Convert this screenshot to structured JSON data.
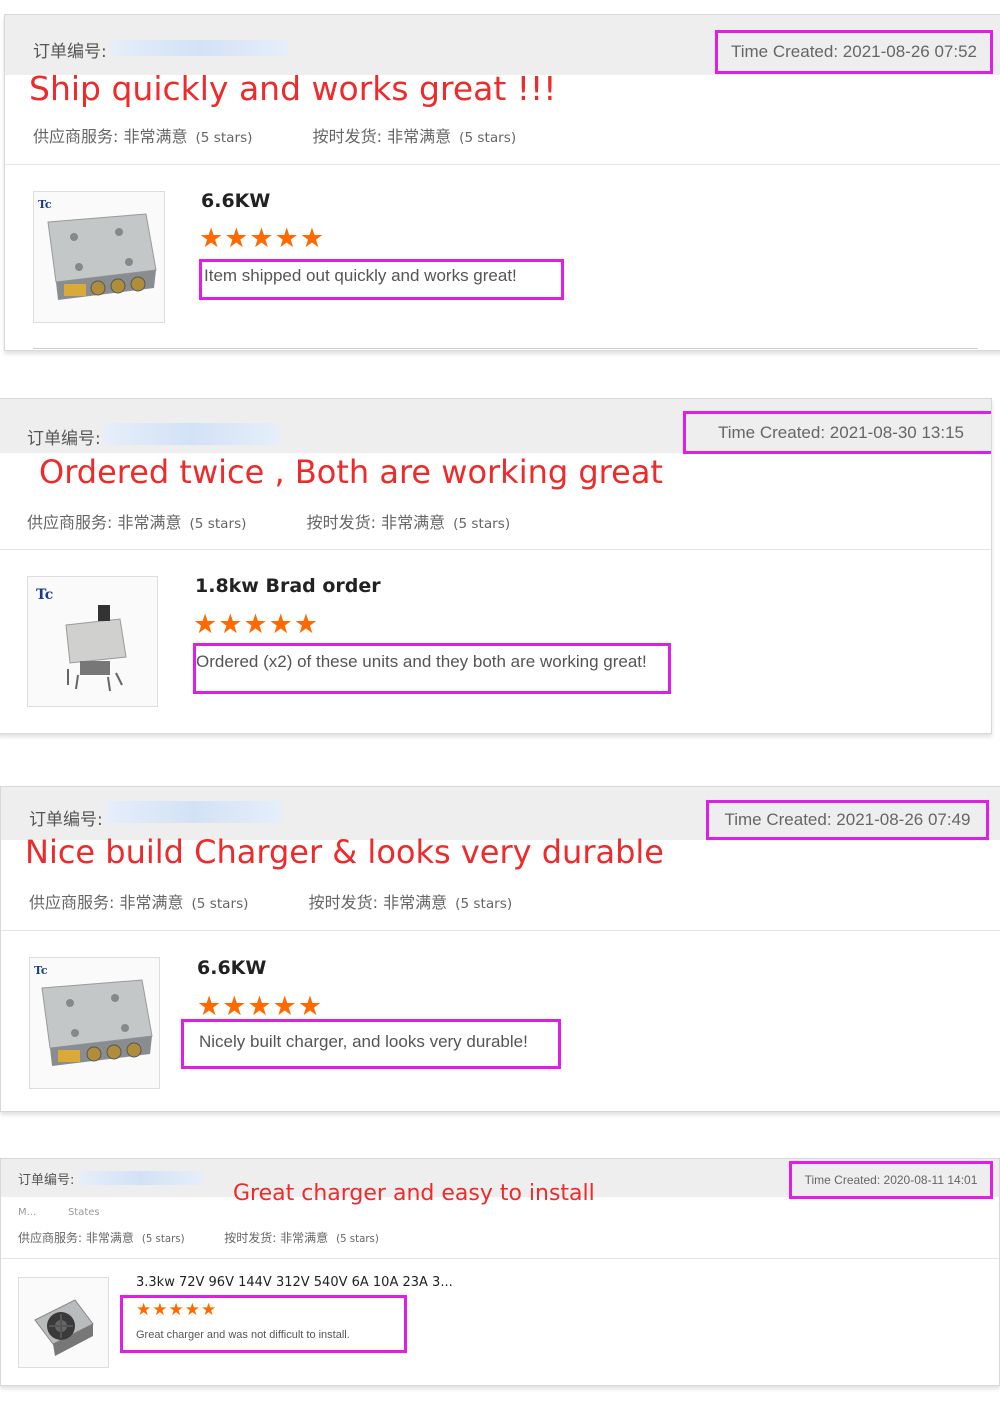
{
  "reviews": [
    {
      "order_label": "订单编号:",
      "time_created": "Time Created: 2021-08-26 07:52",
      "headline": "Ship quickly and works great !!!",
      "supplier_service": "供应商服务: 非常满意",
      "supplier_stars": "(5 stars)",
      "on_time_shipping": "按时发货: 非常满意",
      "shipping_stars": "(5 stars)",
      "product_title": "6.6KW",
      "stars": "★★★★★",
      "review_text": "Item shipped out quickly and works great!"
    },
    {
      "order_label": "订单编号:",
      "time_created": "Time Created: 2021-08-30 13:15",
      "headline": "Ordered twice , Both are working great",
      "supplier_service": "供应商服务: 非常满意",
      "supplier_stars": "(5 stars)",
      "on_time_shipping": "按时发货: 非常满意",
      "shipping_stars": "(5 stars)",
      "product_title": "1.8kw Brad order",
      "stars": "★★★★★",
      "review_text": "Ordered (x2) of these units and they both are working great!"
    },
    {
      "order_label": "订单编号:",
      "time_created": "Time Created: 2021-08-26 07:49",
      "headline": "Nice build Charger & looks very durable",
      "supplier_service": "供应商服务: 非常满意",
      "supplier_stars": "(5 stars)",
      "on_time_shipping": "按时发货: 非常满意",
      "shipping_stars": "(5 stars)",
      "product_title": "6.6KW",
      "stars": "★★★★★",
      "review_text": "Nicely built charger, and looks very durable!"
    },
    {
      "order_label": "订单编号:",
      "time_created": "Time Created: 2020-08-11 14:01",
      "headline": "Great charger and easy to install",
      "buyer_country_partial": "M...          States",
      "supplier_service": "供应商服务: 非常满意",
      "supplier_stars": "(5 stars)",
      "on_time_shipping": "按时发货: 非常满意",
      "shipping_stars": "(5 stars)",
      "product_title": "3.3kw 72V 96V 144V 312V 540V 6A 10A 23A 3...",
      "stars": "★★★★★",
      "review_text": "Great charger and was not difficult to install."
    }
  ],
  "colors": {
    "highlight_box": "#e11ee8",
    "headline_red": "#ee2a2a",
    "star_orange": "#ff6a00",
    "header_grey": "#eeeeee"
  },
  "icons": [
    "charger-product-image"
  ]
}
